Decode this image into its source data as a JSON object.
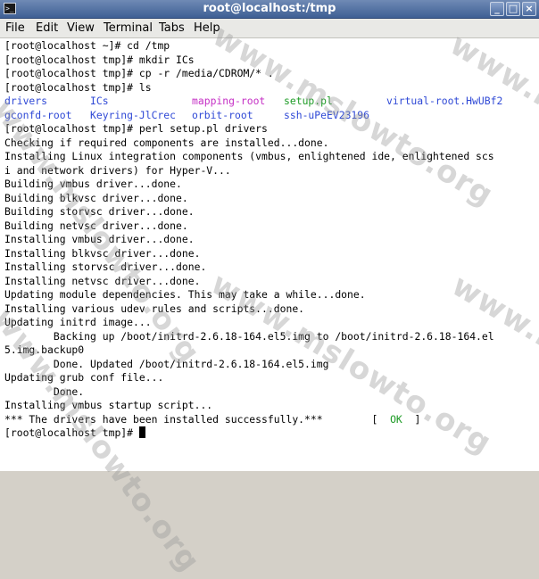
{
  "window": {
    "title": "root@localhost:/tmp",
    "buttons": {
      "minimize": "_",
      "maximize": "□",
      "close": "×"
    }
  },
  "menu": [
    "File",
    "Edit",
    "View",
    "Terminal",
    "Tabs",
    "Help"
  ],
  "terminal": {
    "lines": [
      "[root@localhost ~]# cd /tmp",
      "[root@localhost tmp]# mkdir ICs",
      "[root@localhost tmp]# cp -r /media/CDROM/* .",
      "[root@localhost tmp]# ls"
    ],
    "ls_rows": [
      [
        {
          "text": "drivers",
          "color": "#2f49d6"
        },
        {
          "text": "ICs",
          "color": "#2f49d6"
        },
        {
          "text": "mapping-root",
          "color": "#c530c5"
        },
        {
          "text": "setup.pl",
          "color": "#1d9b25"
        },
        {
          "text": "virtual-root.HwUBf2",
          "color": "#2f49d6"
        }
      ],
      [
        {
          "text": "gconfd-root",
          "color": "#2f49d6"
        },
        {
          "text": "Keyring-JlCrec",
          "color": "#2f49d6"
        },
        {
          "text": "orbit-root",
          "color": "#2f49d6"
        },
        {
          "text": "ssh-uPeEV23196",
          "color": "#2f49d6"
        }
      ]
    ],
    "output_lines": [
      "[root@localhost tmp]# perl setup.pl drivers",
      "Checking if required components are installed...done.",
      "Installing Linux integration components (vmbus, enlightened ide, enlightened scs",
      "i and network drivers) for Hyper-V...",
      "Building vmbus driver...done.",
      "Building blkvsc driver...done.",
      "Building storvsc driver...done.",
      "Building netvsc driver...done.",
      "Installing vmbus driver...done.",
      "Installing blkvsc driver...done.",
      "Installing storvsc driver...done.",
      "Installing netvsc driver...done.",
      "Updating module dependencies. This may take a while...done.",
      "Installing various udev rules and scripts...done.",
      "Updating initrd image...",
      "        Backing up /boot/initrd-2.6.18-164.el5.img to /boot/initrd-2.6.18-164.el",
      "5.img.backup0",
      "        Done. Updated /boot/initrd-2.6.18-164.el5.img",
      "Updating grub conf file...",
      "        Done.",
      "Installing vmbus startup script..."
    ],
    "success": {
      "message": "*** The drivers have been installed successfully.***",
      "spacer": "        ",
      "bracket_open": "[  ",
      "status": "OK",
      "bracket_close": "  ]"
    },
    "prompt": "[root@localhost tmp]# "
  },
  "watermark": "www.mslowto.org"
}
